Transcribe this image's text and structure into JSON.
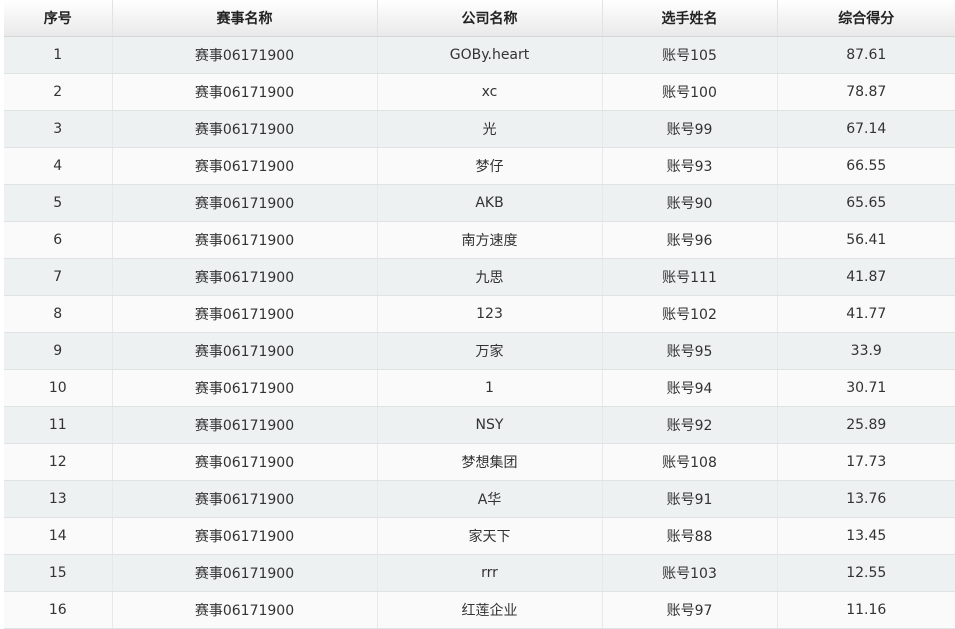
{
  "table": {
    "columns": [
      "序号",
      "赛事名称",
      "公司名称",
      "选手姓名",
      "综合得分"
    ],
    "rows": [
      [
        "1",
        "赛事06171900",
        "GOBy.heart",
        "账号105",
        "87.61"
      ],
      [
        "2",
        "赛事06171900",
        "xc",
        "账号100",
        "78.87"
      ],
      [
        "3",
        "赛事06171900",
        "光",
        "账号99",
        "67.14"
      ],
      [
        "4",
        "赛事06171900",
        "梦仔",
        "账号93",
        "66.55"
      ],
      [
        "5",
        "赛事06171900",
        "AKB",
        "账号90",
        "65.65"
      ],
      [
        "6",
        "赛事06171900",
        "南方速度",
        "账号96",
        "56.41"
      ],
      [
        "7",
        "赛事06171900",
        "九思",
        "账号111",
        "41.87"
      ],
      [
        "8",
        "赛事06171900",
        "123",
        "账号102",
        "41.77"
      ],
      [
        "9",
        "赛事06171900",
        "万家",
        "账号95",
        "33.9"
      ],
      [
        "10",
        "赛事06171900",
        "1",
        "账号94",
        "30.71"
      ],
      [
        "11",
        "赛事06171900",
        "NSY",
        "账号92",
        "25.89"
      ],
      [
        "12",
        "赛事06171900",
        "梦想集团",
        "账号108",
        "17.73"
      ],
      [
        "13",
        "赛事06171900",
        "A华",
        "账号91",
        "13.76"
      ],
      [
        "14",
        "赛事06171900",
        "家天下",
        "账号88",
        "13.45"
      ],
      [
        "15",
        "赛事06171900",
        "rrr",
        "账号103",
        "12.55"
      ],
      [
        "16",
        "赛事06171900",
        "红莲企业",
        "账号97",
        "11.16"
      ]
    ]
  }
}
